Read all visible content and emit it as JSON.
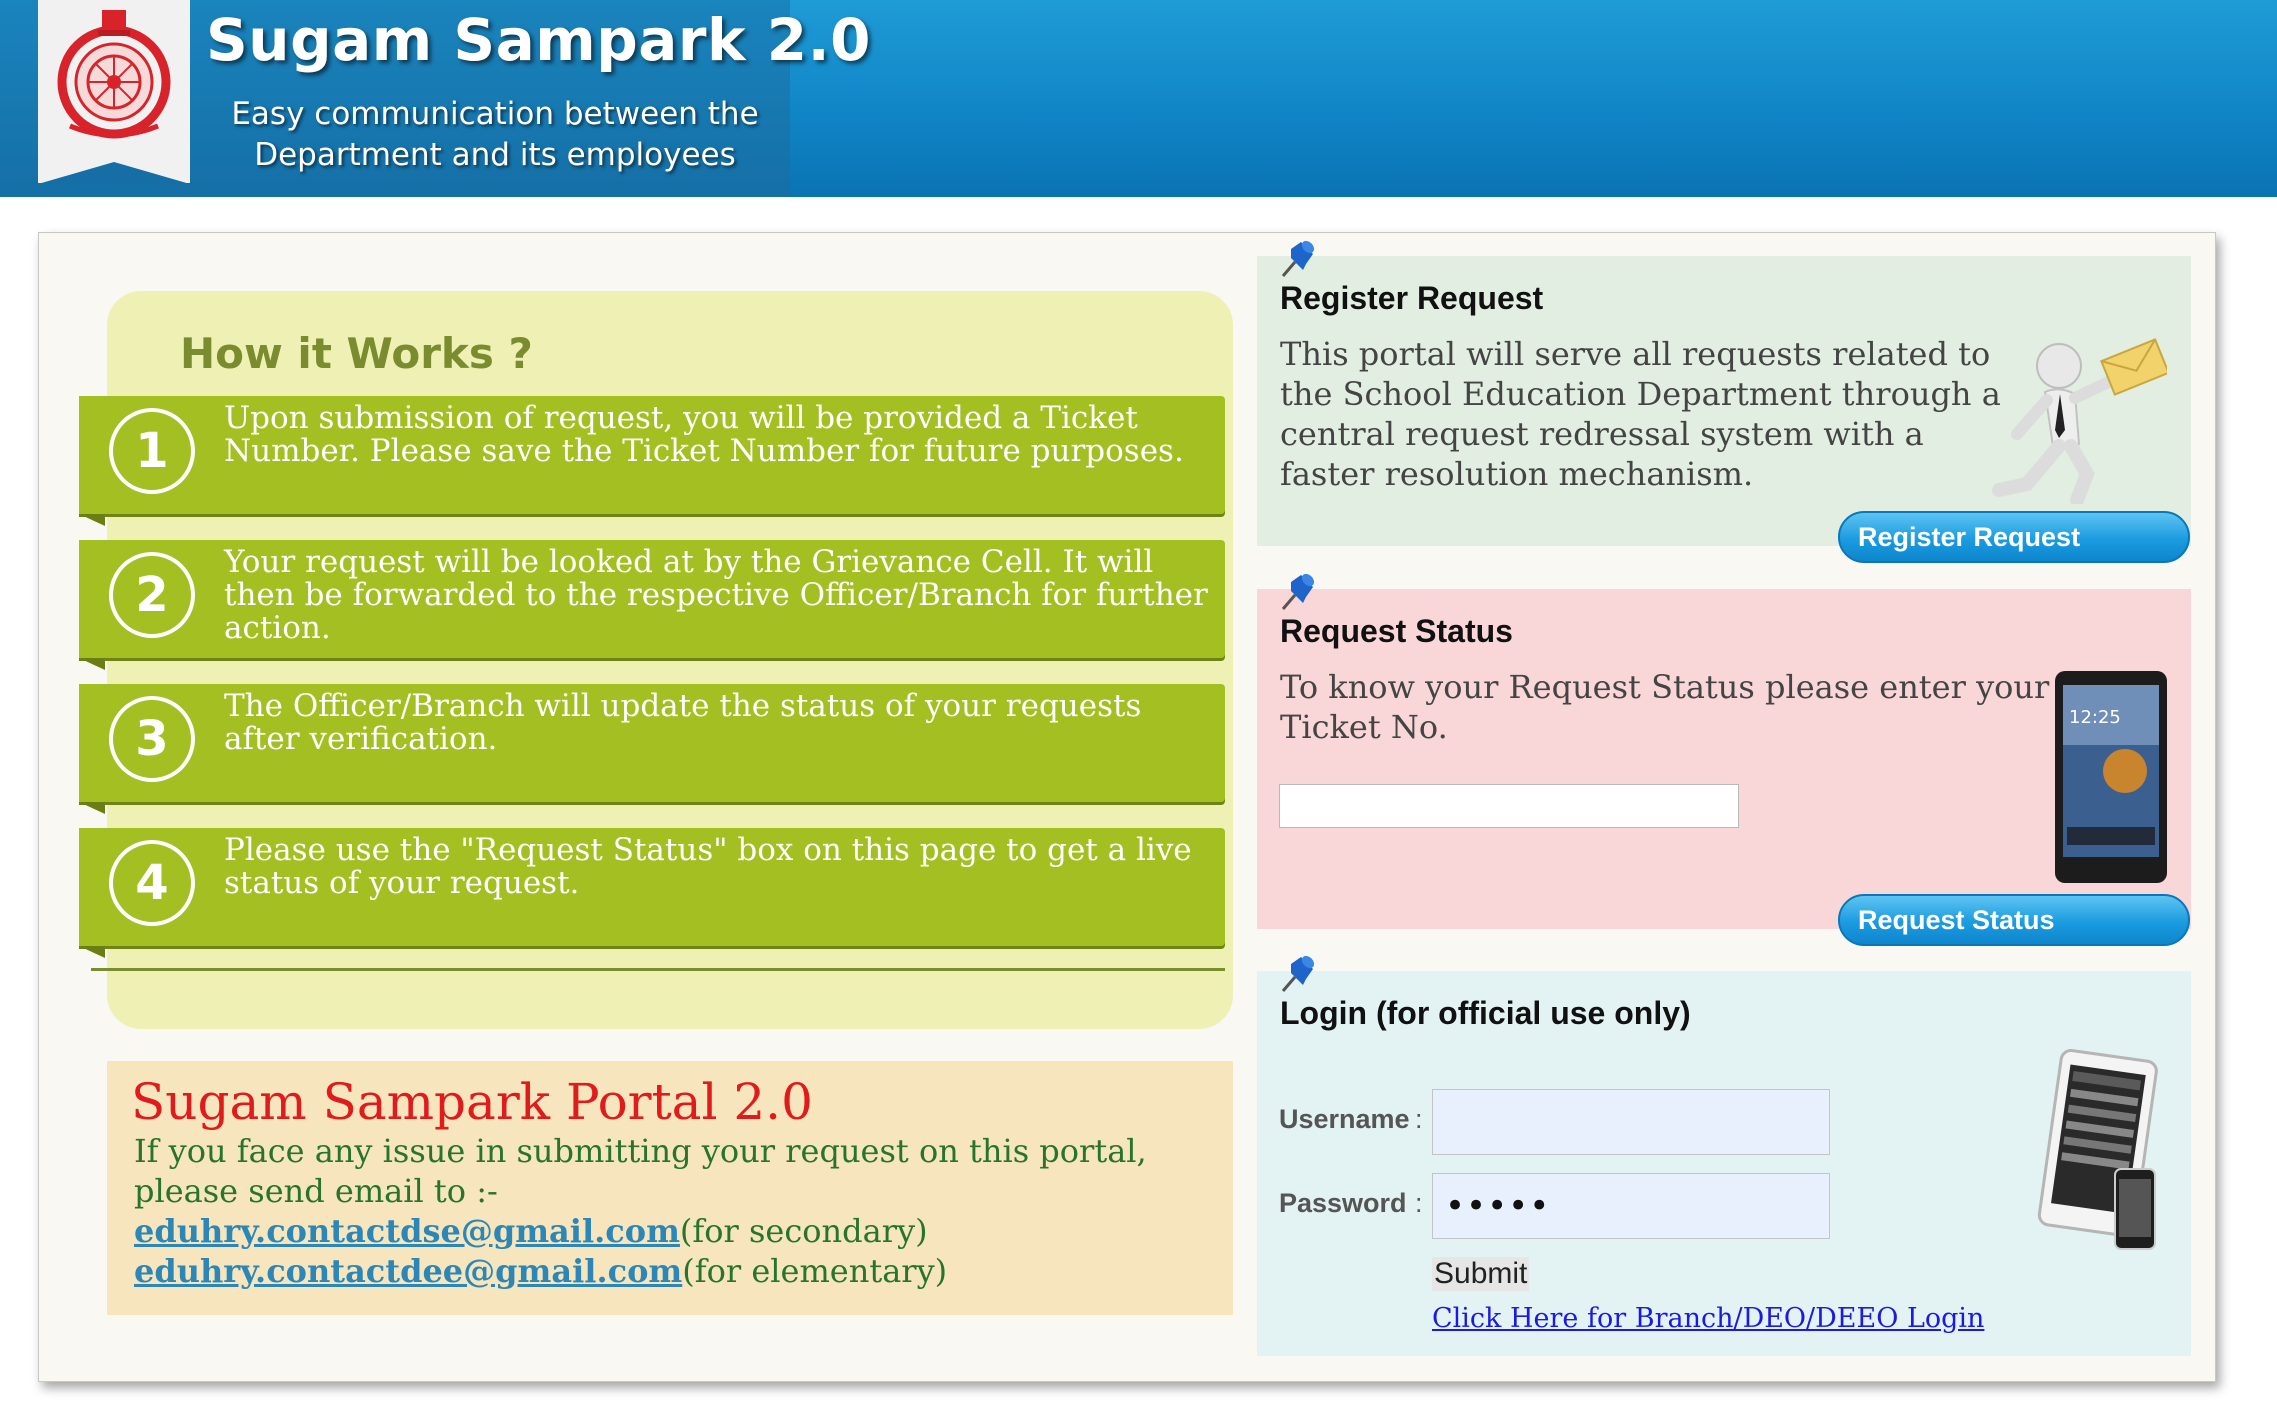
{
  "header": {
    "title": "Sugam Sampark 2.0",
    "subtitle_line1": "Easy communication between the",
    "subtitle_line2": "Department and its employees",
    "emblem_icon": "state-emblem-seal"
  },
  "how_it_works": {
    "title": "How it Works ?",
    "steps": [
      {
        "number": "1",
        "text": "Upon submission of request, you will be provided a Ticket Number. Please save the Ticket Number for future purposes."
      },
      {
        "number": "2",
        "text": "Your request will be looked at by the Grievance Cell. It will then be forwarded to the respective Officer/Branch for further action."
      },
      {
        "number": "3",
        "text": "The Officer/Branch will update the status of your requests after verification."
      },
      {
        "number": "4",
        "text": "Please use the \"Request Status\" box on this page to get a live status of your request."
      }
    ]
  },
  "portal_info": {
    "title": "Sugam Sampark Portal 2.0",
    "text": "If you face any issue in submitting your request on this portal, please send email to :-",
    "email1": "eduhry.contactdse@gmail.com",
    "email1_note": "(for secondary)",
    "email2": "eduhry.contactdee@gmail.com",
    "email2_note": "(for elementary)"
  },
  "register": {
    "title": "Register Request",
    "text_lines": [
      "This portal will serve all requests related to",
      "the School Education Department through a",
      "central request redressal system with a",
      "faster resolution mechanism."
    ],
    "button": "Register Request",
    "icon": "running-person-envelope-icon"
  },
  "status": {
    "title": "Request Status",
    "text_lines": [
      "To know your Request Status please enter your",
      "Ticket No."
    ],
    "input_value": "",
    "button": "Request Status",
    "icon": "tablet-icon"
  },
  "login": {
    "title": "Login (for official use only)",
    "username_label": "Username",
    "password_label": "Password",
    "username_value": "",
    "password_value": "•••••",
    "submit": "Submit",
    "branch_link": "Click Here for Branch/DEO/DEEO Login",
    "icon": "devices-icon"
  },
  "colors": {
    "header_blue": "#1186c7",
    "step_green": "#a3bf21",
    "how_bg": "#eff0b4",
    "info_bg": "#f6e5bd",
    "register_bg": "#e2eee2",
    "status_bg": "#f9d6d7",
    "login_bg": "#e3f2f2",
    "button_blue": "#1b9be0",
    "info_title_red": "#e01b1b",
    "info_text_green": "#27742a"
  }
}
